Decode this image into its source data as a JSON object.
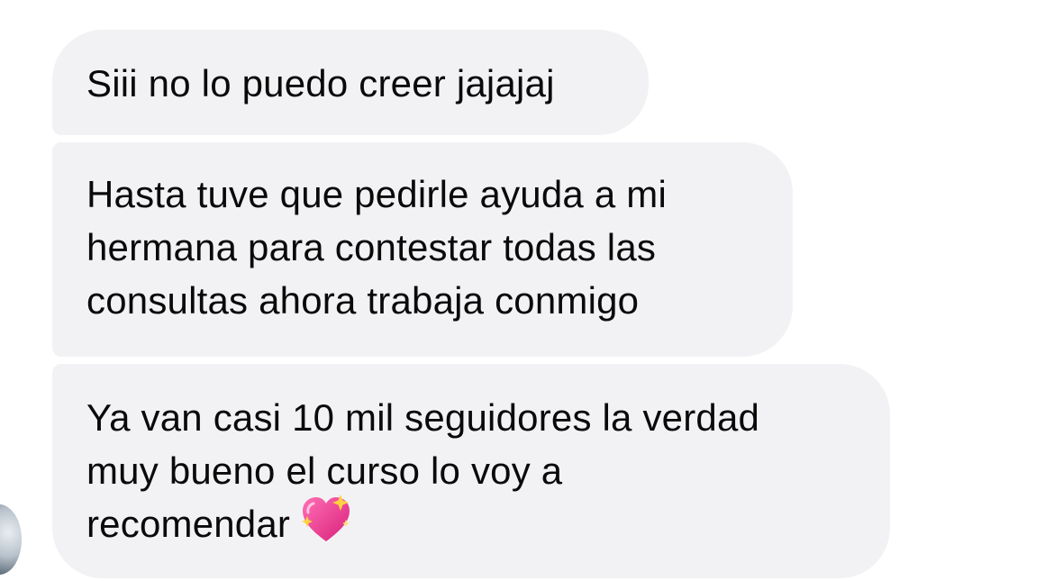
{
  "messages": [
    {
      "lines": [
        "Siii no lo puedo creer jajajaj"
      ]
    },
    {
      "lines": [
        "Hasta tuve que pedirle ayuda a mi",
        "hermana para contestar todas las",
        "consultas ahora trabaja conmigo"
      ]
    },
    {
      "lines": [
        "Ya van casi 10 mil seguidores la verdad",
        "muy bueno el curso lo voy a",
        "recomendar"
      ],
      "emoji": "sparkling-heart"
    }
  ],
  "colors": {
    "bubble_background": "#f2f2f5",
    "text": "#0a0a0a",
    "emoji_pink": "#e8368f"
  }
}
